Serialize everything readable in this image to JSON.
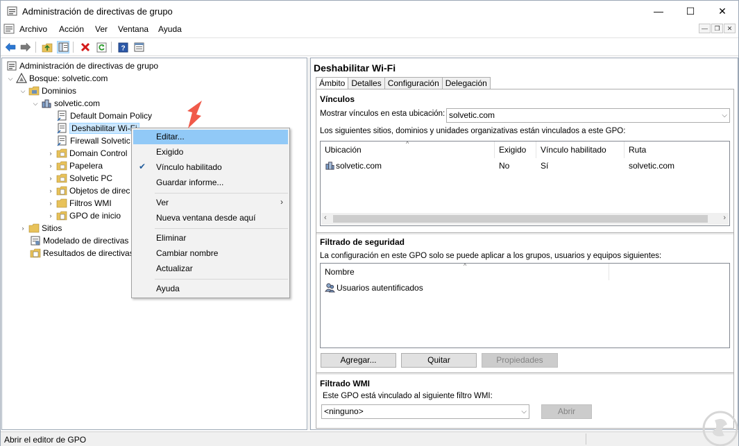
{
  "window": {
    "title": "Administración de directivas de grupo",
    "controls": {
      "minimize": "—",
      "maximize": "☐",
      "close": "✕"
    }
  },
  "menubar": {
    "items": [
      "Archivo",
      "Acción",
      "Ver",
      "Ventana",
      "Ayuda"
    ]
  },
  "toolbar": {
    "icons": [
      "back-arrow-icon",
      "forward-arrow-icon",
      "up-folder-icon",
      "show-tree-icon",
      "delete-icon",
      "refresh-icon",
      "help-icon",
      "properties-icon"
    ]
  },
  "tree": {
    "root": "Administración de directivas de grupo",
    "forest": "Bosque: solvetic.com",
    "domains": "Dominios",
    "domain": "solvetic.com",
    "children": [
      "Default Domain Policy",
      "Deshabilitar Wi-Fi",
      "Firewall Solvetic",
      "Domain Control",
      "Papelera",
      "Solvetic PC",
      "Objetos de direc",
      "Filtros WMI",
      "GPO de inicio"
    ],
    "sites": "Sitios",
    "modeling": "Modelado de directivas",
    "results": "Resultados de directivas"
  },
  "context_menu": {
    "items": [
      "Editar...",
      "Exigido",
      "Vínculo habilitado",
      "Guardar informe...",
      "Ver",
      "Nueva ventana desde aquí",
      "Eliminar",
      "Cambiar nombre",
      "Actualizar",
      "Ayuda"
    ],
    "checked": "Vínculo habilitado",
    "highlighted": "Editar..."
  },
  "right": {
    "title": "Deshabilitar Wi-Fi",
    "tabs": [
      "Ámbito",
      "Detalles",
      "Configuración",
      "Delegación"
    ],
    "links": {
      "title": "Vínculos",
      "show_label": "Mostrar vínculos en esta ubicación:",
      "location_value": "solvetic.com",
      "description": "Los siguientes sitios, dominios y unidades organizativas están vinculados a este GPO:",
      "columns": [
        "Ubicación",
        "Exigido",
        "Vínculo habilitado",
        "Ruta"
      ],
      "rows": [
        {
          "location": "solvetic.com",
          "enforced": "No",
          "enabled": "Sí",
          "path": "solvetic.com"
        }
      ]
    },
    "security": {
      "title": "Filtrado de seguridad",
      "description": "La configuración en este GPO solo se puede aplicar a los grupos, usuarios y equipos siguientes:",
      "columns": [
        "Nombre"
      ],
      "rows": [
        "Usuarios autentificados"
      ],
      "buttons": {
        "add": "Agregar...",
        "remove": "Quitar",
        "properties": "Propiedades"
      }
    },
    "wmi": {
      "title": "Filtrado WMI",
      "description": "Este GPO está vinculado al siguiente filtro WMI:",
      "value": "<ninguno>",
      "open_button": "Abrir"
    }
  },
  "statusbar": {
    "text": "Abrir el editor de GPO"
  },
  "colors": {
    "highlight": "#91c9f7",
    "selected": "#cce8ff",
    "arrow": "#f05a4a"
  }
}
